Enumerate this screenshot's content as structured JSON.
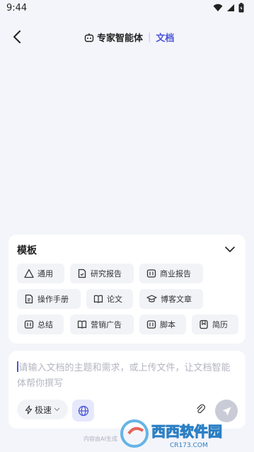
{
  "status_bar": {
    "time": "9:44"
  },
  "header": {
    "title": "专家智能体",
    "active_tab": "文档"
  },
  "templates": {
    "title": "模板",
    "items": [
      {
        "label": "通用",
        "icon": "triangle-icon"
      },
      {
        "label": "研究报告",
        "icon": "report-icon"
      },
      {
        "label": "商业报告",
        "icon": "book-icon"
      },
      {
        "label": "操作手册",
        "icon": "manual-icon"
      },
      {
        "label": "论文",
        "icon": "open-book-icon"
      },
      {
        "label": "博客文章",
        "icon": "grad-cap-icon"
      },
      {
        "label": "总结",
        "icon": "book-icon"
      },
      {
        "label": "营销广告",
        "icon": "open-book-icon"
      },
      {
        "label": "脚本",
        "icon": "book-icon"
      },
      {
        "label": "简历",
        "icon": "resume-icon"
      }
    ]
  },
  "composer": {
    "placeholder": "请输入文档的主题和需求，或上传文件，让文档智能体帮你撰写",
    "speed_label": "极速"
  },
  "footer": {
    "disclaimer": "内容由AI生成"
  },
  "watermark": {
    "text": "西西软件园",
    "sub": "CR173.COM"
  },
  "colors": {
    "accent": "#4b54d8",
    "background": "#f4f5fa"
  }
}
